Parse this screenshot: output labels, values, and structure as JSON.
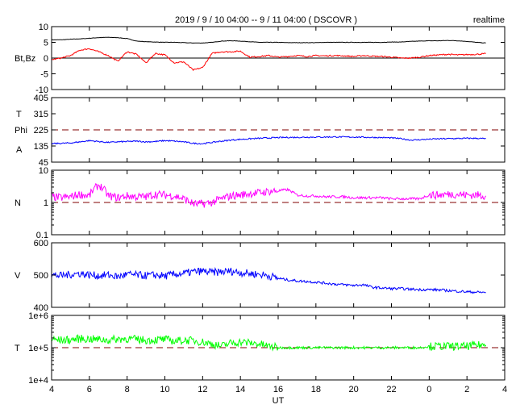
{
  "chart_data": {
    "type": "line",
    "title": "2019 / 9 / 10  04:00 -- 9 / 11  04:00 ( DSCOVR )",
    "mode_label": "realtime",
    "xlabel": "UT",
    "xlim": [
      4,
      28
    ],
    "x_tick_labels": [
      "4",
      "6",
      "8",
      "10",
      "12",
      "14",
      "16",
      "18",
      "20",
      "22",
      "0",
      "2",
      "4"
    ],
    "x": [
      4,
      4.5,
      5,
      5.5,
      6,
      6.5,
      7,
      7.5,
      8,
      8.5,
      9,
      9.5,
      10,
      10.5,
      11,
      11.5,
      12,
      12.5,
      13,
      13.5,
      14,
      14.5,
      15,
      15.5,
      16,
      16.5,
      17,
      17.5,
      18,
      18.5,
      19,
      19.5,
      20,
      20.5,
      21,
      21.5,
      22,
      22.5,
      23,
      23.5,
      24,
      24.5,
      25,
      25.5,
      26,
      26.5,
      27
    ],
    "panels": [
      {
        "ylabel": "Bt,Bz",
        "scale": "linear",
        "ylim": [
          -10,
          10
        ],
        "tick_labels": [
          "10",
          "5",
          "0",
          "-5",
          "-10"
        ],
        "tick_values": [
          10,
          5,
          0,
          -5,
          -10
        ],
        "reference_line": {
          "value": 0,
          "style": "solid",
          "color": "#000000"
        },
        "series": [
          {
            "name": "Bt",
            "color": "#000000",
            "values": [
              5.8,
              5.8,
              6.0,
              6.1,
              6.3,
              6.5,
              6.6,
              6.5,
              6.2,
              5.4,
              5.2,
              5.1,
              5.0,
              5.0,
              4.9,
              4.8,
              4.8,
              5.0,
              5.4,
              5.5,
              5.4,
              5.2,
              5.0,
              5.0,
              5.0,
              4.9,
              4.9,
              4.9,
              4.9,
              5.0,
              5.0,
              5.0,
              5.0,
              5.0,
              5.0,
              5.0,
              5.1,
              5.1,
              5.3,
              5.4,
              5.5,
              5.5,
              5.6,
              5.5,
              5.3,
              5.0,
              4.8
            ]
          },
          {
            "name": "Bz",
            "color": "#ff0000",
            "values": [
              -0.5,
              0,
              0.8,
              2.5,
              3,
              2,
              0.8,
              -1,
              2,
              1.2,
              -1.5,
              1.5,
              1,
              -1.5,
              -1.2,
              -3.8,
              -3,
              1.5,
              2,
              2,
              2.2,
              0.3,
              0.5,
              0.8,
              0.3,
              0.5,
              0.8,
              0.5,
              0.8,
              0.7,
              0.8,
              0.7,
              0.5,
              0.8,
              0.6,
              0.5,
              0.3,
              0,
              0,
              0.3,
              0.8,
              1,
              1.2,
              1,
              1.1,
              1.2,
              1.4
            ]
          }
        ]
      },
      {
        "ylabel": [
          "T",
          "Phi",
          "A"
        ],
        "scale": "linear",
        "ylim": [
          45,
          405
        ],
        "tick_labels": [
          "405",
          "315",
          "225",
          "135",
          "45"
        ],
        "tick_values": [
          405,
          315,
          225,
          135,
          45
        ],
        "reference_line": {
          "value": 225,
          "style": "dashed",
          "color": "#800000"
        },
        "series": [
          {
            "name": "Phi",
            "color": "#0000ff",
            "values": [
              148,
              150,
              152,
              158,
              165,
              160,
              155,
              158,
              160,
              162,
              158,
              160,
              165,
              162,
              158,
              150,
              148,
              155,
              162,
              168,
              172,
              175,
              178,
              180,
              182,
              183,
              183,
              184,
              185,
              185,
              186,
              185,
              185,
              184,
              183,
              182,
              180,
              176,
              168,
              170,
              173,
              175,
              176,
              177,
              178,
              178,
              176
            ]
          }
        ]
      },
      {
        "ylabel": "N",
        "scale": "log",
        "ylim": [
          0.1,
          10
        ],
        "tick_labels": [
          "10",
          "1",
          "0.1"
        ],
        "tick_values": [
          10,
          1,
          0.1
        ],
        "reference_line": {
          "value": 1,
          "style": "dashed",
          "color": "#800000"
        },
        "series": [
          {
            "name": "N",
            "color": "#ff00ff",
            "values": [
              1.5,
              1.4,
              1.5,
              1.8,
              1.6,
              3.5,
              1.6,
              1.4,
              1.6,
              1.5,
              1.5,
              1.8,
              1.7,
              1.6,
              1.3,
              0.9,
              0.9,
              1.0,
              1.3,
              1.6,
              1.7,
              1.9,
              2.0,
              2.2,
              2.3,
              2.5,
              1.7,
              1.6,
              1.6,
              1.5,
              1.5,
              1.5,
              1.4,
              1.4,
              1.4,
              1.4,
              1.3,
              1.3,
              1.3,
              1.3,
              1.7,
              1.7,
              1.8,
              1.8,
              1.7,
              1.7,
              1.6
            ]
          }
        ]
      },
      {
        "ylabel": "V",
        "scale": "linear",
        "ylim": [
          400,
          600
        ],
        "tick_labels": [
          "600",
          "500",
          "400"
        ],
        "tick_values": [
          600,
          500,
          400
        ],
        "series": [
          {
            "name": "V",
            "color": "#0000ff",
            "values": [
              500,
              498,
              502,
              505,
              500,
              498,
              500,
              495,
              502,
              500,
              498,
              500,
              497,
              502,
              505,
              510,
              512,
              508,
              510,
              512,
              508,
              505,
              502,
              498,
              490,
              485,
              482,
              480,
              478,
              475,
              472,
              470,
              468,
              470,
              462,
              460,
              458,
              458,
              456,
              455,
              455,
              454,
              452,
              450,
              448,
              447,
              446
            ]
          }
        ]
      },
      {
        "ylabel": "T",
        "scale": "log",
        "ylim": [
          10000,
          1000000
        ],
        "tick_labels": [
          "1e+6",
          "1e+5",
          "1e+4"
        ],
        "tick_values": [
          1000000,
          100000,
          10000
        ],
        "reference_line": {
          "value": 100000,
          "style": "dashed",
          "color": "#800000"
        },
        "series": [
          {
            "name": "T",
            "color": "#00ff00",
            "values": [
              180000,
              170000,
              175000,
              190000,
              185000,
              180000,
              170000,
              185000,
              190000,
              180000,
              170000,
              175000,
              180000,
              160000,
              170000,
              165000,
              150000,
              130000,
              110000,
              140000,
              150000,
              140000,
              130000,
              110000,
              100000,
              100000,
              100000,
              100000,
              100000,
              100000,
              100000,
              100000,
              100000,
              100000,
              100000,
              100000,
              100000,
              100000,
              100000,
              100000,
              110000,
              110000,
              110000,
              110000,
              110000,
              120000,
              120000
            ]
          }
        ]
      }
    ]
  }
}
